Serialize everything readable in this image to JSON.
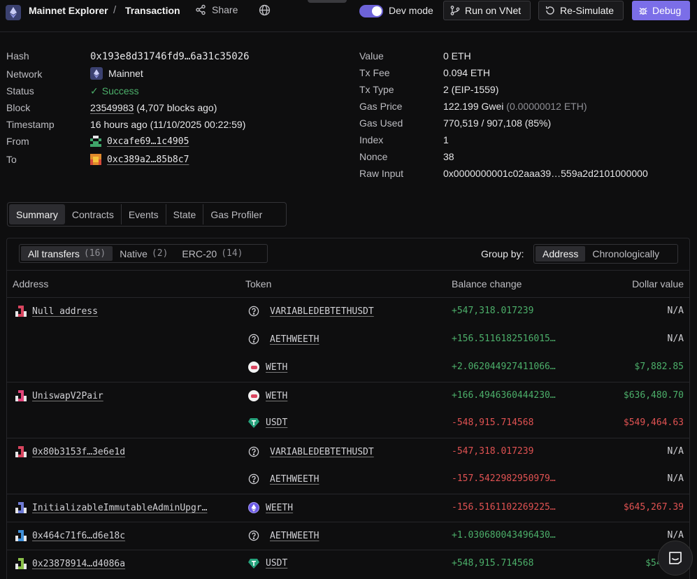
{
  "header": {
    "brand": "Mainnet Explorer",
    "separator": "/",
    "crumb": "Transaction",
    "share_label": "Share",
    "dev_mode_label": "Dev mode",
    "dev_mode_on": true,
    "run_vnet_label": "Run on VNet",
    "resimulate_label": "Re-Simulate",
    "debug_label": "Debug",
    "accent_color": "#7b6ee8"
  },
  "details_left": [
    {
      "label": "Hash",
      "value": "0x193e8d31746fd9…6a31c35026"
    },
    {
      "label": "Network",
      "value": "Mainnet"
    },
    {
      "label": "Status",
      "value": "Success"
    },
    {
      "label": "Block",
      "value": "23549983",
      "extra": "(4,707 blocks ago)"
    },
    {
      "label": "Timestamp",
      "value": "16 hours ago (11/10/2025 00:22:59)"
    },
    {
      "label": "From",
      "value": "0xcafe69…1c4905"
    },
    {
      "label": "To",
      "value": "0xc389a2…85b8c7"
    }
  ],
  "details_right": [
    {
      "label": "Value",
      "value": "0 ETH"
    },
    {
      "label": "Tx Fee",
      "value": "0.094 ETH"
    },
    {
      "label": "Tx Type",
      "value": "2 (EIP-1559)"
    },
    {
      "label": "Gas Price",
      "value": "122.199 Gwei",
      "extra": "(0.00000012 ETH)"
    },
    {
      "label": "Gas Used",
      "value": "770,519 / 907,108 (85%)"
    },
    {
      "label": "Index",
      "value": "1"
    },
    {
      "label": "Nonce",
      "value": "38"
    },
    {
      "label": "Raw Input",
      "value": "0x0000000001c02aaa39…559a2d2101000000"
    }
  ],
  "tabs": [
    "Summary",
    "Contracts",
    "Events",
    "State",
    "Gas Profiler"
  ],
  "filters": [
    {
      "label": "All transfers",
      "count": "(16)"
    },
    {
      "label": "Native",
      "count": "(2)"
    },
    {
      "label": "ERC-20",
      "count": "(14)"
    }
  ],
  "group_by": {
    "label": "Group by:",
    "options": [
      "Address",
      "Chronologically"
    ],
    "selected": "Address"
  },
  "columns": [
    "Address",
    "Token",
    "Balance change",
    "Dollar value"
  ],
  "rows": [
    {
      "address": "Null address",
      "token": "VARIABLEDEBTETHUSDT",
      "token_icon": "unknown-icon",
      "balance": "+547,318.017239",
      "usd": "N/A"
    },
    {
      "address": "",
      "token": "AETHWEETH",
      "token_icon": "unknown-icon",
      "balance": "+156.5116182516015…",
      "usd": "N/A"
    },
    {
      "address": "",
      "token": "WETH",
      "token_icon": "weth-icon",
      "balance": "+2.062044927411066…",
      "usd": "$7,882.85"
    },
    {
      "address": "UniswapV2Pair",
      "token": "WETH",
      "token_icon": "weth-icon",
      "balance": "+166.4946360444230…",
      "usd": "$636,480.70"
    },
    {
      "address": "",
      "token": "USDT",
      "token_icon": "usdt-icon",
      "balance": "-548,915.714568",
      "usd": "$549,464.63"
    },
    {
      "address": "0x80b3153f…3e6e1d",
      "token": "VARIABLEDEBTETHUSDT",
      "token_icon": "unknown-icon",
      "balance": "-547,318.017239",
      "usd": "N/A"
    },
    {
      "address": "",
      "token": "AETHWEETH",
      "token_icon": "unknown-icon",
      "balance": "-157.5422982950979…",
      "usd": "N/A"
    },
    {
      "address": "InitializableImmutableAdminUpgr…",
      "token": "WEETH",
      "token_icon": "weeth-icon",
      "balance": "-156.5161102269225…",
      "usd": "$645,267.39"
    },
    {
      "address": "0x464c71f6…d6e18c",
      "token": "AETHWEETH",
      "token_icon": "unknown-icon",
      "balance": "+1.030680043496430…",
      "usd": "N/A"
    },
    {
      "address": "0x23878914…d4086a",
      "token": "USDT",
      "token_icon": "usdt-icon",
      "balance": "+548,915.714568",
      "usd": "$549,46"
    }
  ]
}
